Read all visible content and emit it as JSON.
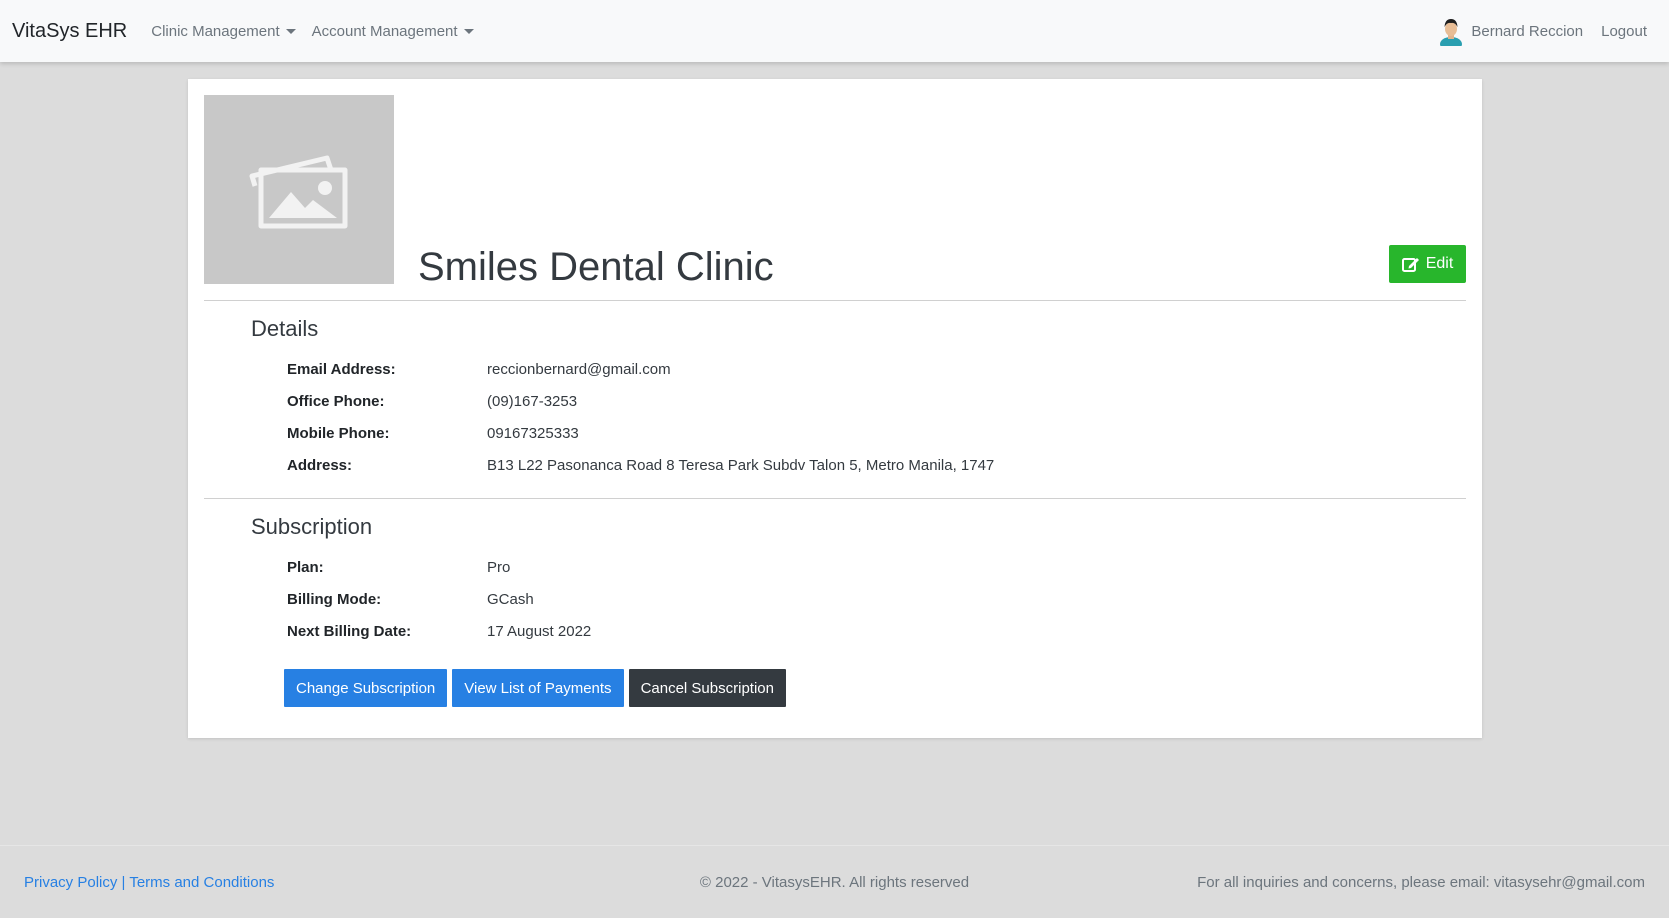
{
  "navbar": {
    "brand": "VitaSys EHR",
    "menu": [
      "Clinic Management",
      "Account Management"
    ],
    "user_name": "Bernard Reccion",
    "logout": "Logout"
  },
  "clinic": {
    "name": "Smiles Dental Clinic",
    "edit_label": "Edit"
  },
  "details": {
    "title": "Details",
    "rows": [
      {
        "label": "Email Address:",
        "value": "reccionbernard@gmail.com"
      },
      {
        "label": "Office Phone:",
        "value": "(09)167-3253"
      },
      {
        "label": "Mobile Phone:",
        "value": "09167325333"
      },
      {
        "label": "Address:",
        "value": "B13 L22 Pasonanca Road 8 Teresa Park Subdv Talon 5, Metro Manila, 1747"
      }
    ]
  },
  "subscription": {
    "title": "Subscription",
    "rows": [
      {
        "label": "Plan:",
        "value": "Pro"
      },
      {
        "label": "Billing Mode:",
        "value": "GCash"
      },
      {
        "label": "Next Billing Date:",
        "value": "17 August 2022"
      }
    ],
    "buttons": {
      "change": "Change Subscription",
      "payments": "View List of Payments",
      "cancel": "Cancel Subscription"
    }
  },
  "footer": {
    "privacy": "Privacy Policy",
    "separator": "|",
    "terms": "Terms and Conditions",
    "copyright": "© 2022 - VitasysEHR. All rights reserved",
    "inquiry": "For all inquiries and concerns, please email: vitasysehr@gmail.com"
  },
  "colors": {
    "primary": "#2780e3",
    "success": "#28b62c",
    "dark": "#343a40",
    "background": "#dcdcdc"
  }
}
